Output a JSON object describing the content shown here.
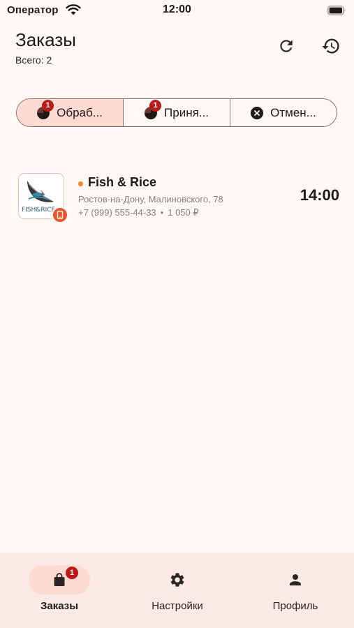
{
  "status_bar": {
    "carrier": "Оператор",
    "time": "12:00"
  },
  "header": {
    "title": "Заказы",
    "subtitle": "Всего: 2",
    "refresh_icon": "refresh-icon",
    "history_icon": "history-icon"
  },
  "filters": [
    {
      "label": "Обраб...",
      "badge": "1",
      "selected": true,
      "icon": "processing-icon"
    },
    {
      "label": "Приня...",
      "badge": "1",
      "selected": false,
      "icon": "accepted-icon"
    },
    {
      "label": "Отмен...",
      "badge": "",
      "selected": false,
      "icon": "cancel-circle-icon"
    }
  ],
  "orders": [
    {
      "shop_name": "Fish & Rice",
      "logo_text": "FISH&RICE",
      "address": "Ростов-на-Дону, Малиновского, 78",
      "phone": "+7 (999) 555-44-33",
      "separator": "•",
      "amount": "1 050 ₽",
      "time": "14:00",
      "status_color": "#f28b2a",
      "source_icon": "phone-icon"
    }
  ],
  "bottom_nav": [
    {
      "label": "Заказы",
      "icon": "bag-icon",
      "badge": "1",
      "active": true
    },
    {
      "label": "Настройки",
      "icon": "gear-icon",
      "badge": "",
      "active": false
    },
    {
      "label": "Профиль",
      "icon": "person-icon",
      "badge": "",
      "active": false
    }
  ],
  "colors": {
    "background": "#fff8f5",
    "accent_container": "#ffdad3",
    "badge": "#ba1a1a",
    "nav_background": "#fbe9e4",
    "outline": "#857370"
  }
}
